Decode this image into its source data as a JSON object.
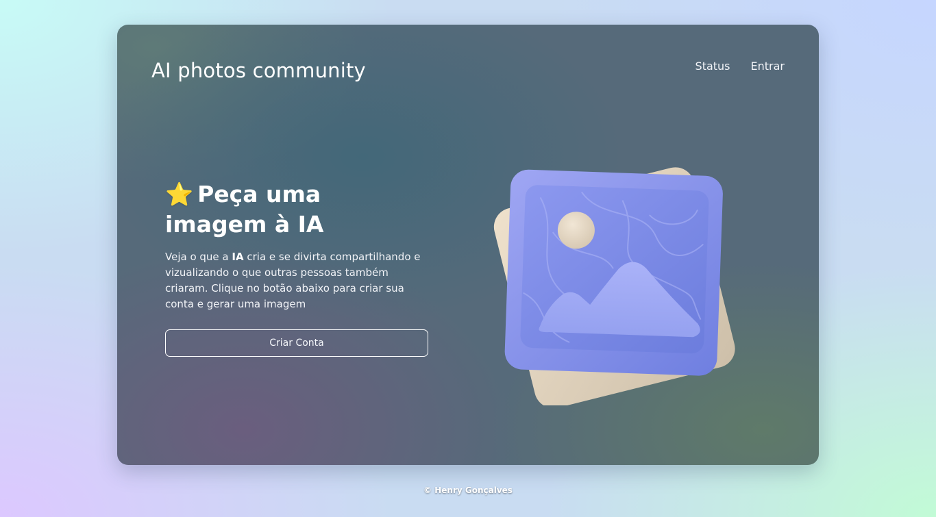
{
  "header": {
    "brand": "AI photos community",
    "nav": [
      {
        "label": "Status"
      },
      {
        "label": "Entrar"
      }
    ]
  },
  "hero": {
    "title_icon": "star-icon",
    "title_icon_glyph": "⭐",
    "title": "Peça uma imagem à IA",
    "description_before": "Veja o que a ",
    "description_bold": "IA",
    "description_after": " cria e se divirta compartilhando e vizualizando o que outras pessoas também criaram. Clique no botão abaixo para criar sua conta e gerar uma imagem",
    "cta_label": "Criar Conta"
  },
  "illustration": {
    "icon": "image-gallery-icon"
  },
  "footer": {
    "text": "© Henry Gonçalves"
  }
}
